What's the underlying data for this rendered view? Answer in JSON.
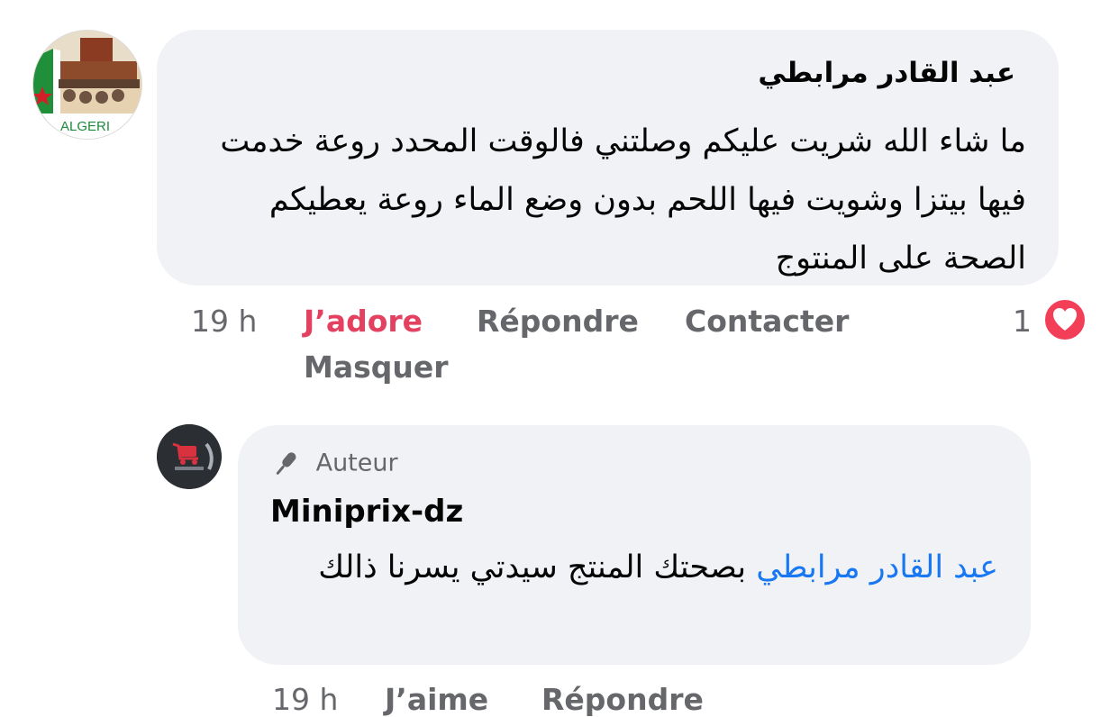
{
  "comment": {
    "author": "عبد القادر مرابطي",
    "avatar_text": "ALGERI",
    "text": "ما شاء الله شريت عليكم وصلتني فالوقت المحدد روعة خدمت فيها بيتزا وشويت فيها اللحم بدون وضع الماء روعة يعطيكم الصحة على المنتوج",
    "time": "19 h",
    "actions": {
      "love": "J’adore",
      "reply": "Répondre",
      "contact": "Contacter",
      "hide": "Masquer"
    },
    "reaction": {
      "count": "1",
      "icon": "heart-icon",
      "color": "#f33e58"
    }
  },
  "reply": {
    "badge": "Auteur",
    "badge_icon": "microphone-icon",
    "author": "Miniprix-dz",
    "mention": "عبد القادر مرابطي",
    "text": "بصحتك المنتج سيدتي يسرنا ذالك",
    "time": "19 h",
    "actions": {
      "like": "J’aime",
      "reply": "Répondre"
    }
  },
  "colors": {
    "love": "#e4405f",
    "mention": "#1877f2",
    "bubble": "#f0f2f5",
    "muted": "#65676b"
  }
}
